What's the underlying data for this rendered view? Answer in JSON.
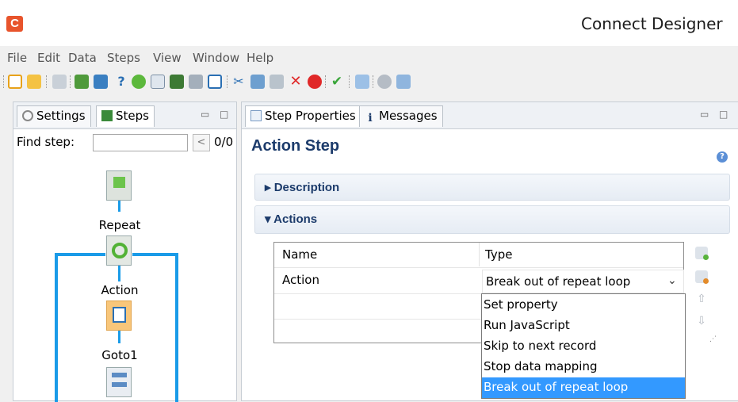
{
  "window": {
    "title": "Connect Designer",
    "logo_letter": "C"
  },
  "menu": [
    "File",
    "Edit",
    "Data",
    "Steps",
    "View",
    "Window",
    "Help"
  ],
  "left_panel": {
    "tabs": [
      {
        "label": "Settings",
        "icon": "gear-icon",
        "active": false
      },
      {
        "label": "Steps",
        "icon": "steps-icon",
        "active": true
      }
    ],
    "find_label": "Find step:",
    "find_value": "",
    "find_prev": "<",
    "find_count": "0/0",
    "flow_nodes": [
      {
        "label": "Repeat",
        "icon": "flag-icon"
      },
      {
        "label": "Action",
        "icon": "repeat-icon"
      },
      {
        "label": "Goto1",
        "icon": "script-icon"
      },
      {
        "label": "",
        "icon": "goto-icon"
      }
    ]
  },
  "right_panel": {
    "tabs": [
      {
        "label": "Step Properties",
        "icon": "properties-icon",
        "active": true
      },
      {
        "label": "Messages",
        "icon": "info-icon",
        "active": false
      }
    ],
    "form_title": "Action Step",
    "sections": [
      {
        "label": "Description",
        "expanded": false
      },
      {
        "label": "Actions",
        "expanded": true
      }
    ],
    "table": {
      "headers": [
        "Name",
        "Type"
      ],
      "rows": [
        {
          "name": "Action",
          "type": "Break out of repeat loop"
        }
      ]
    },
    "dropdown_options": [
      {
        "label": "Set property",
        "selected": false
      },
      {
        "label": "Run JavaScript",
        "selected": false
      },
      {
        "label": "Skip to next record",
        "selected": false
      },
      {
        "label": "Stop data mapping",
        "selected": false
      },
      {
        "label": "Break out of repeat loop",
        "selected": true
      }
    ],
    "side_buttons": [
      "add-row-icon",
      "delete-row-icon",
      "move-up-icon",
      "move-down-icon"
    ]
  },
  "colors": {
    "accent": "#1a9be8",
    "selection": "#3399ff",
    "title": "#1c3b6b",
    "logo": "#e8542c"
  }
}
